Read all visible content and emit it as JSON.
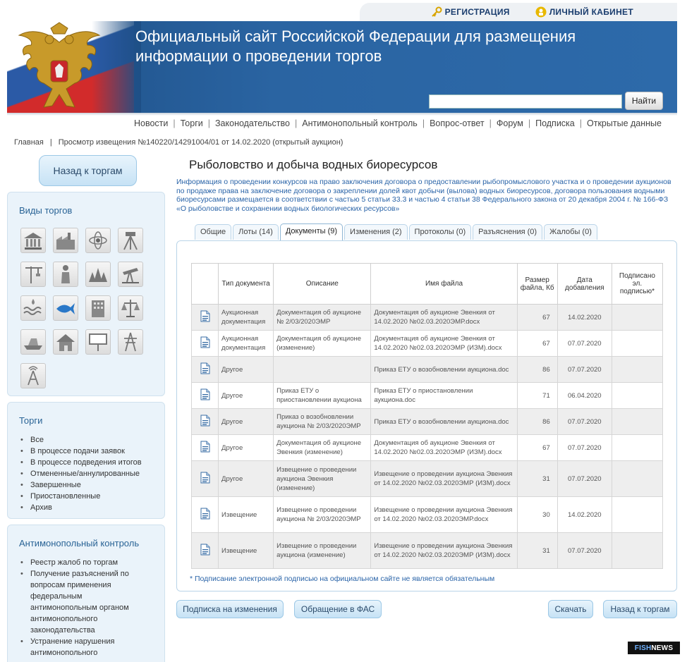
{
  "topbar": {
    "register_label": "РЕГИСТРАЦИЯ",
    "cabinet_label": "ЛИЧНЫЙ КАБИНЕТ"
  },
  "header": {
    "title_line1": "Официальный сайт Российской Федерации для размещения",
    "title_line2": "информации о проведении торгов",
    "search_value": "",
    "search_button": "Найти"
  },
  "mainnav": [
    "Новости",
    "Торги",
    "Законодательство",
    "Антимонопольный контроль",
    "Вопрос-ответ",
    "Форум",
    "Подписка",
    "Открытые данные"
  ],
  "breadcrumb": {
    "home": "Главная",
    "current": "Просмотр извещения №140220/14291004/01 от 14.02.2020 (открытый аукцион)"
  },
  "sidebar": {
    "back_button": "Назад к торгам",
    "types_title": "Виды торгов",
    "tile_icons": [
      "museum-icon",
      "factory-icon",
      "atom-icon",
      "surveyor-icon",
      "crane-icon",
      "worker-icon",
      "forest-icon",
      "oil-pump-icon",
      "water-icon",
      "fish-icon",
      "building-icon",
      "scales-icon",
      "boat-icon",
      "house-icon",
      "billboard-icon",
      "power-tower-icon",
      "antenna-icon"
    ],
    "torgi_title": "Торги",
    "torgi_items": [
      "Все",
      "В процессе подачи заявок",
      "В процессе подведения итогов",
      "Отмененные/аннулированные",
      "Завершенные",
      "Приостановленные",
      "Архив"
    ],
    "anti_title": "Антимонопольный контроль",
    "anti_items": [
      "Реестр жалоб по торгам",
      "Получение разъяснений по вопросам применения федеральным антимонопольным органом антимонопольного законодательства",
      "Устранение нарушения антимонопольного законодательства"
    ]
  },
  "content": {
    "title": "Рыболовство и добыча водных биоресурсов",
    "description": "Информация о проведении конкурсов на право заключения договора о предоставлении рыбопромыслового участка и о проведении аукционов по продаже права на заключение договора о закреплении долей квот добычи (вылова) водных биоресурсов, договора пользования водными биоресурсами размещается в соответствии с частью 5 статьи 33.3 и частью 4 статьи 38 Федерального закона от 20 декабря 2004 г. № 166-ФЗ «О рыболовстве и сохранении водных биологических ресурсов»",
    "tabs": [
      "Общие",
      "Лоты (14)",
      "Документы (9)",
      "Изменения (2)",
      "Протоколы (0)",
      "Разъяснения (0)",
      "Жалобы (0)"
    ],
    "active_tab": "Документы (9)",
    "table": {
      "headers": [
        "Тип документа",
        "Описание",
        "Имя файла",
        "Размер файла, Кб",
        "Дата добавления",
        "Подписано эл. подписью*"
      ],
      "rows": [
        {
          "type": "Аукционная документация",
          "desc": "Документация об аукционе № 2/03/2020ЭМР",
          "file": "Документация об аукционе Эвенкия от 14.02.2020 №02.03.2020ЭМР.docx",
          "size": "67",
          "date": "14.02.2020",
          "signed": ""
        },
        {
          "type": "Аукционная документация",
          "desc": "Документация об аукционе (изменение)",
          "file": "Документация об аукционе Эвенкия от 14.02.2020 №02.03.2020ЭМР (ИЗМ).docx",
          "size": "67",
          "date": "07.07.2020",
          "signed": ""
        },
        {
          "type": "Другое",
          "desc": "",
          "file": "Приказ ЕТУ о возобновлении аукциона.doc",
          "size": "86",
          "date": "07.07.2020",
          "signed": ""
        },
        {
          "type": "Другое",
          "desc": "Приказ ЕТУ о приостановлении аукциона",
          "file": "Приказ ЕТУ о приостановлении аукциона.doc",
          "size": "71",
          "date": "06.04.2020",
          "signed": ""
        },
        {
          "type": "Другое",
          "desc": "Приказ о возобновлении аукциона № 2/03/2020ЭМР",
          "file": "Приказ ЕТУ о возобновлении аукциона.doc",
          "size": "86",
          "date": "07.07.2020",
          "signed": ""
        },
        {
          "type": "Другое",
          "desc": "Документация об аукционе Эвенкия (изменение)",
          "file": "Документация об аукционе Эвенкия от 14.02.2020 №02.03.2020ЭМР (ИЗМ).docx",
          "size": "67",
          "date": "07.07.2020",
          "signed": ""
        },
        {
          "type": "Другое",
          "desc": "Извещение о проведении аукциона Эвенкия (изменение)",
          "file": "Извещение о проведении аукциона Эвенкия от 14.02.2020 №02.03.2020ЭМР (ИЗМ).docx",
          "size": "31",
          "date": "07.07.2020",
          "signed": ""
        },
        {
          "type": "Извещение",
          "desc": "Извещение о проведении аукциона № 2/03/2020ЭМР",
          "file": "Извещение о проведении аукциона Эвенкия от 14.02.2020 №02.03.2020ЭМР.docx",
          "size": "30",
          "date": "14.02.2020",
          "signed": ""
        },
        {
          "type": "Извещение",
          "desc": "Извещение о проведении аукциона (изменение)",
          "file": "Извещение о проведении аукциона Эвенкия от 14.02.2020 №02.03.2020ЭМР (ИЗМ).docx",
          "size": "31",
          "date": "07.07.2020",
          "signed": ""
        }
      ]
    },
    "footnote": "* Подписание электронной подписью на официальном сайте не является обязательным"
  },
  "buttons": {
    "subscribe": "Подписка на изменения",
    "fas": "Обращение в ФАС",
    "download": "Скачать",
    "back": "Назад к торгам"
  },
  "watermark": {
    "part1": "FISH",
    "part2": "NEWS"
  },
  "colors": {
    "banner": "#2a64a2",
    "link": "#2a64a8",
    "sidebar_bg": "#eaf3fa"
  }
}
